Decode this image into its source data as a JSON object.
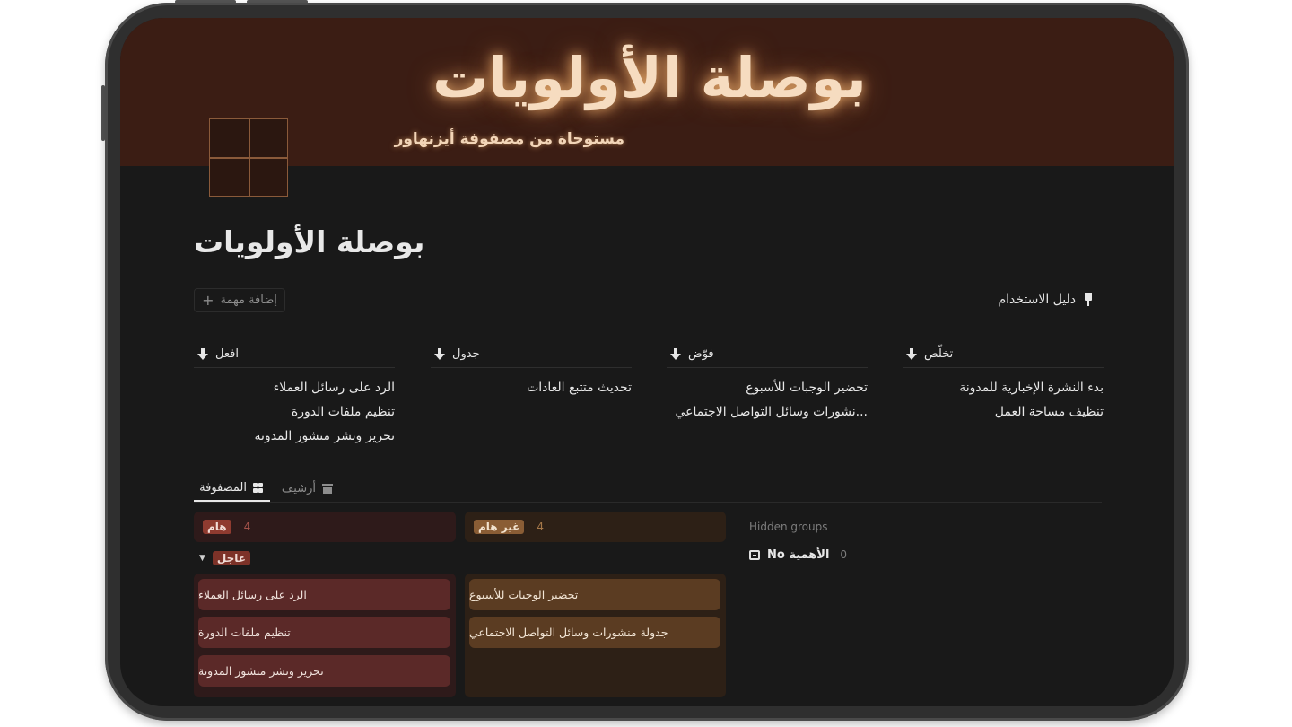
{
  "cover": {
    "title": "بوصلة الأولويات",
    "subtitle": "مستوحاة من مصفوفة أيزنهاور"
  },
  "page": {
    "title": "بوصلة الأولويات"
  },
  "toolbar": {
    "guide_label": "دليل الاستخدام",
    "add_task_label": "إضافة مهمة"
  },
  "quadrants": [
    {
      "label": "تخلّص",
      "items": [
        "بدء النشرة الإخبارية للمدونة",
        "تنظيف مساحة العمل"
      ]
    },
    {
      "label": "فوّض",
      "items": [
        "تحضير الوجبات للأسبوع",
        "...نشورات وسائل التواصل الاجتماعي"
      ]
    },
    {
      "label": "جدول",
      "items": [
        "تحديث متتبع العادات"
      ]
    },
    {
      "label": "افعل",
      "items": [
        "الرد على رسائل العملاء",
        "تنظيم ملفات الدورة",
        "تحرير ونشر منشور المدونة"
      ]
    }
  ],
  "tabs": {
    "matrix": "المصفوفة",
    "archive": "أرشيف"
  },
  "board": {
    "groups": [
      {
        "tag": "هام",
        "count": "4"
      },
      {
        "tag": "غير هام",
        "count": "4"
      }
    ],
    "subgroup": {
      "tag": "عاجل"
    },
    "lanes": {
      "important": [
        "الرد على رسائل العملاء",
        "تنظيم ملفات الدورة",
        "تحرير ونشر منشور المدونة"
      ],
      "not_important": [
        "تحضير الوجبات للأسبوع",
        "جدولة منشورات وسائل التواصل الاجتماعي"
      ]
    },
    "hidden": {
      "label": "Hidden groups",
      "group_label": "No الأهمية",
      "group_count": "0"
    }
  },
  "colors": {
    "background": "#191919",
    "cover": "#3b1d14",
    "important": "#8f3b30",
    "not_important": "#8a5d35"
  }
}
